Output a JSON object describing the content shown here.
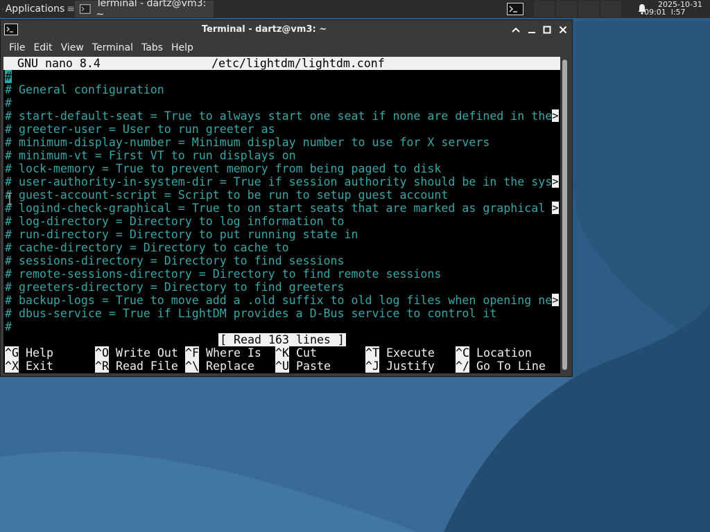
{
  "panel": {
    "apps_label": "Applications",
    "task_label": "Terminal - dartz@vm3: ~",
    "clock_date": "2025-10-31",
    "clock_time": "09:01  l:57"
  },
  "window": {
    "title": "Terminal - dartz@vm3: ~",
    "menu": [
      "File",
      "Edit",
      "View",
      "Terminal",
      "Tabs",
      "Help"
    ]
  },
  "nano": {
    "version": "GNU nano 8.4",
    "filename": "/etc/lightdm/lightdm.conf",
    "lines": [
      "#",
      "# General configuration",
      "#",
      "# start-default-seat = True to always start one seat if none are defined in the",
      "# greeter-user = User to run greeter as",
      "# minimum-display-number = Minimum display number to use for X servers",
      "# minimum-vt = First VT to run displays on",
      "# lock-memory = True to prevent memory from being paged to disk",
      "# user-authority-in-system-dir = True if session authority should be in the sys",
      "# guest-account-script = Script to be run to setup guest account",
      "# logind-check-graphical = True to on start seats that are marked as graphical ",
      "# log-directory = Directory to log information to",
      "# run-directory = Directory to put running state in",
      "# cache-directory = Directory to cache to",
      "# sessions-directory = Directory to find sessions",
      "# remote-sessions-directory = Directory to find remote sessions",
      "# greeters-directory = Directory to find greeters",
      "# backup-logs = True to move add a .old suffix to old log files when opening ne",
      "# dbus-service = True if LightDM provides a D-Bus service to control it",
      "#"
    ],
    "more_marker": ">",
    "status": "[ Read 163 lines ]",
    "shortcuts_row1": [
      {
        "key": "^G",
        "label": "Help"
      },
      {
        "key": "^O",
        "label": "Write Out"
      },
      {
        "key": "^F",
        "label": "Where Is"
      },
      {
        "key": "^K",
        "label": "Cut"
      },
      {
        "key": "^T",
        "label": "Execute"
      },
      {
        "key": "^C",
        "label": "Location"
      }
    ],
    "shortcuts_row2": [
      {
        "key": "^X",
        "label": "Exit"
      },
      {
        "key": "^R",
        "label": "Read File"
      },
      {
        "key": "^\\",
        "label": "Replace"
      },
      {
        "key": "^U",
        "label": "Paste"
      },
      {
        "key": "^J",
        "label": "Justify"
      },
      {
        "key": "^/",
        "label": "Go To Line"
      }
    ]
  }
}
